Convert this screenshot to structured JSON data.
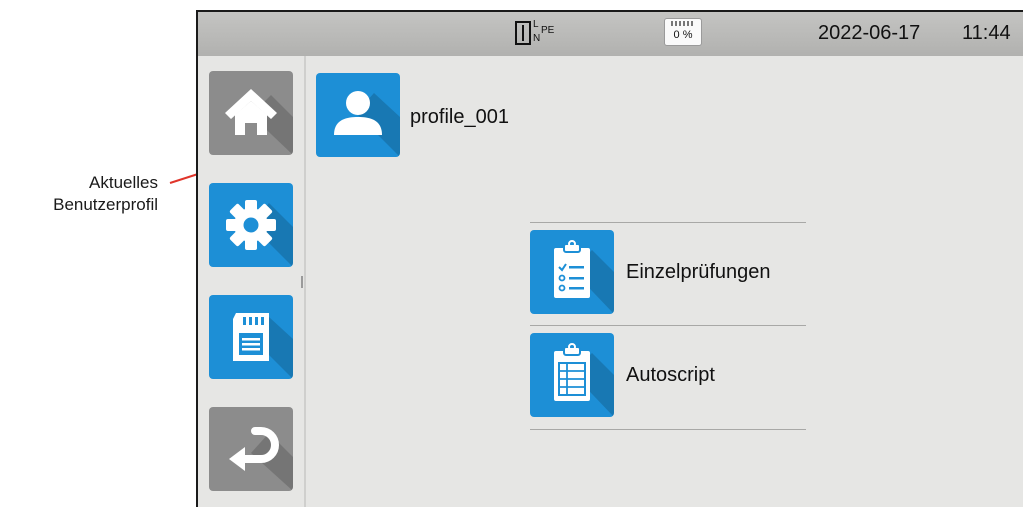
{
  "annotation": {
    "line1": "Aktuelles",
    "line2": "Benutzerprofil"
  },
  "status_bar": {
    "connection_icon": "l-n-pe-connection-icon",
    "connection_l": "L",
    "connection_n": "N",
    "connection_pe": "PE",
    "sd_icon": "sd-card-icon",
    "sd_usage": "0 %",
    "date": "2022-06-17",
    "time": "11:44"
  },
  "sidebar": {
    "items": [
      {
        "icon": "home-icon",
        "color": "#8c8c8c"
      },
      {
        "icon": "gear-icon",
        "color": "#1d8fd6"
      },
      {
        "icon": "sd-card-icon",
        "color": "#1d8fd6"
      },
      {
        "icon": "return-arrow-icon",
        "color": "#8c8c8c"
      }
    ]
  },
  "profile": {
    "icon": "user-icon",
    "name": "profile_001"
  },
  "menu": {
    "items": [
      {
        "icon": "checklist-clipboard-icon",
        "label": "Einzelprüfungen"
      },
      {
        "icon": "script-clipboard-icon",
        "label": "Autoscript"
      }
    ]
  },
  "colors": {
    "accent_blue": "#1d8fd6",
    "inactive_grey": "#8c8c8c",
    "screen_bg": "#e6e6e4",
    "callout_red": "#e0352b"
  }
}
